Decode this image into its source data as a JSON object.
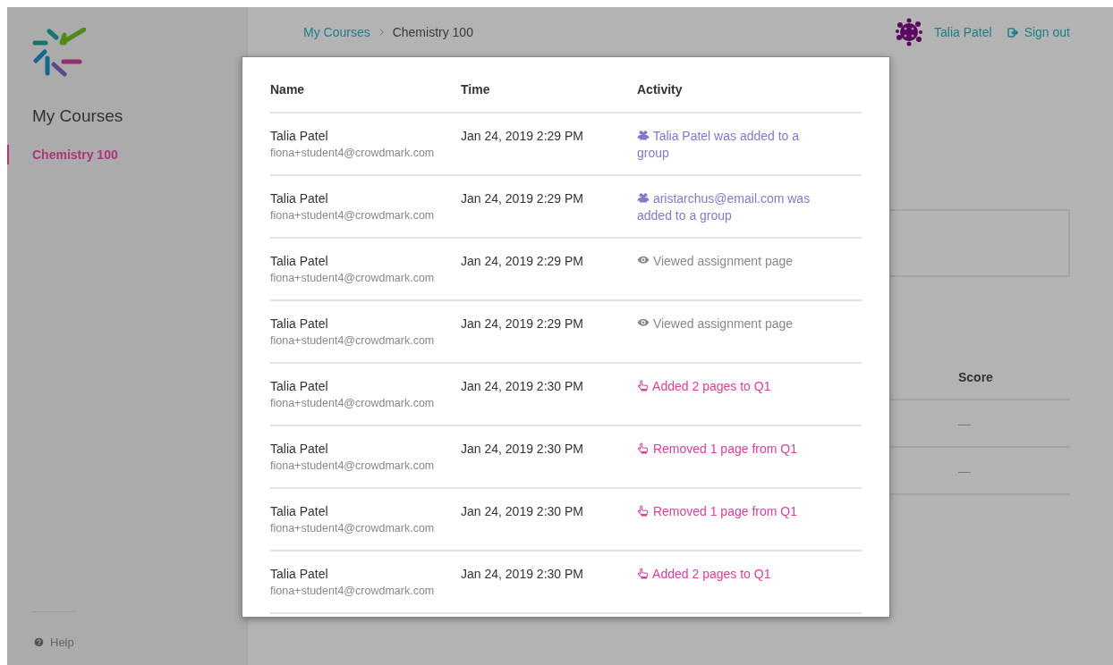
{
  "sidebar": {
    "section_title": "My Courses",
    "items": [
      {
        "label": "Chemistry 100",
        "selected": true
      }
    ],
    "help": "Help"
  },
  "header": {
    "breadcrumbs": [
      "My Courses",
      "Chemistry 100"
    ],
    "user": "Talia Patel",
    "sign_out": "Sign out"
  },
  "background_table": {
    "columns": [
      "Score"
    ],
    "rows": [
      [
        "—"
      ],
      [
        "—"
      ]
    ]
  },
  "modal": {
    "columns": [
      "Name",
      "Time",
      "Activity"
    ],
    "rows": [
      {
        "name": "Talia Patel",
        "email": "fiona+student4@crowdmark.com",
        "time": "Jan 24, 2019 2:29 PM",
        "activity": {
          "kind": "group",
          "text": "Talia Patel was added to a group"
        }
      },
      {
        "name": "Talia Patel",
        "email": "fiona+student4@crowdmark.com",
        "time": "Jan 24, 2019 2:29 PM",
        "activity": {
          "kind": "group",
          "text": "aristarchus@email.com was added to a group"
        }
      },
      {
        "name": "Talia Patel",
        "email": "fiona+student4@crowdmark.com",
        "time": "Jan 24, 2019 2:29 PM",
        "activity": {
          "kind": "view",
          "text": "Viewed assignment page"
        }
      },
      {
        "name": "Talia Patel",
        "email": "fiona+student4@crowdmark.com",
        "time": "Jan 24, 2019 2:29 PM",
        "activity": {
          "kind": "view",
          "text": "Viewed assignment page"
        }
      },
      {
        "name": "Talia Patel",
        "email": "fiona+student4@crowdmark.com",
        "time": "Jan 24, 2019 2:30 PM",
        "activity": {
          "kind": "page",
          "text": "Added 2 pages to Q1"
        }
      },
      {
        "name": "Talia Patel",
        "email": "fiona+student4@crowdmark.com",
        "time": "Jan 24, 2019 2:30 PM",
        "activity": {
          "kind": "page",
          "text": "Removed 1 page from Q1"
        }
      },
      {
        "name": "Talia Patel",
        "email": "fiona+student4@crowdmark.com",
        "time": "Jan 24, 2019 2:30 PM",
        "activity": {
          "kind": "page",
          "text": "Removed 1 page from Q1"
        }
      },
      {
        "name": "Talia Patel",
        "email": "fiona+student4@crowdmark.com",
        "time": "Jan 24, 2019 2:30 PM",
        "activity": {
          "kind": "page",
          "text": "Added 2 pages to Q1"
        }
      }
    ]
  }
}
